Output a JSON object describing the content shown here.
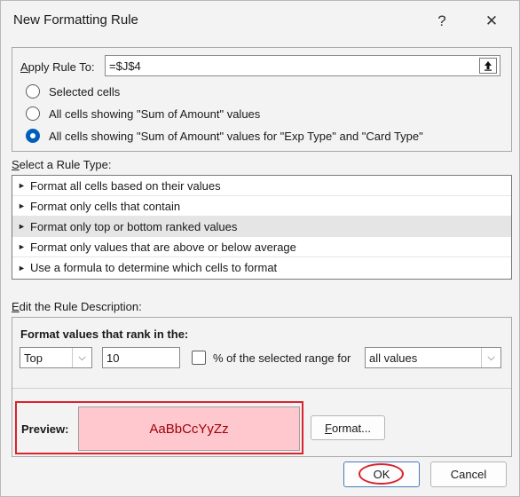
{
  "dialog": {
    "title": "New Formatting Rule",
    "help_glyph": "?",
    "close_glyph": "✕"
  },
  "apply_rule": {
    "label": "Apply Rule To:",
    "value": "=$J$4",
    "collapse_icon": "upload-arrow-icon"
  },
  "scope_options": [
    {
      "label": "Selected cells",
      "checked": false
    },
    {
      "label": "All cells showing \"Sum of Amount\" values",
      "checked": false
    },
    {
      "label": "All cells showing \"Sum of Amount\" values for \"Exp Type\" and \"Card Type\"",
      "checked": true
    }
  ],
  "rule_type": {
    "label": "Select a Rule Type:",
    "items": [
      {
        "label": "Format all cells based on their values",
        "selected": false
      },
      {
        "label": "Format only cells that contain",
        "selected": false
      },
      {
        "label": "Format only top or bottom ranked values",
        "selected": true
      },
      {
        "label": "Format only values that are above or below average",
        "selected": false
      },
      {
        "label": "Use a formula to determine which cells to format",
        "selected": false
      }
    ],
    "arrow_glyph": "►"
  },
  "description": {
    "label": "Edit the Rule Description:",
    "rank_heading": "Format values that rank in the:",
    "rank_select": "Top",
    "rank_value": "10",
    "percent_label": "% of the selected range for",
    "percent_checked": false,
    "range_select": "all values",
    "dropdown_glyph": "⌵"
  },
  "preview": {
    "label": "Preview:",
    "sample_text": "AaBbCcYyZz",
    "fill_color": "#ffc7ce",
    "font_color": "#9c0006",
    "format_button": "Format..."
  },
  "buttons": {
    "ok": "OK",
    "cancel": "Cancel"
  },
  "annotation_color": "#d9232d"
}
